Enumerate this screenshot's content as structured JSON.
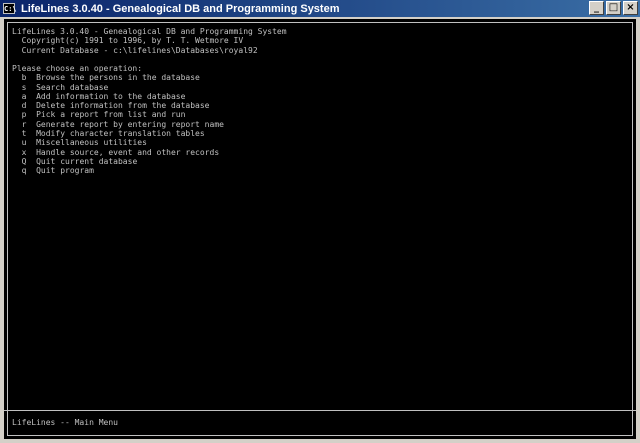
{
  "window": {
    "title": "LifeLines 3.0.40 - Genealogical DB and Programming System",
    "minimize": "_",
    "maximize": "□",
    "close": "×"
  },
  "header": {
    "line1": "LifeLines 3.0.40 - Genealogical DB and Programming System",
    "line2": "  Copyright(c) 1991 to 1996, by T. T. Wetmore IV",
    "line3": "  Current Database - c:\\lifelines\\Databases\\royal92"
  },
  "menu": {
    "prompt": "Please choose an operation:",
    "items": [
      {
        "key": "b",
        "label": "Browse the persons in the database"
      },
      {
        "key": "s",
        "label": "Search database"
      },
      {
        "key": "a",
        "label": "Add information to the database"
      },
      {
        "key": "d",
        "label": "Delete information from the database"
      },
      {
        "key": "p",
        "label": "Pick a report from list and run"
      },
      {
        "key": "r",
        "label": "Generate report by entering report name"
      },
      {
        "key": "t",
        "label": "Modify character translation tables"
      },
      {
        "key": "u",
        "label": "Miscellaneous utilities"
      },
      {
        "key": "x",
        "label": "Handle source, event and other records"
      },
      {
        "key": "Q",
        "label": "Quit current database"
      },
      {
        "key": "q",
        "label": "Quit program"
      }
    ]
  },
  "status": "LifeLines -- Main Menu"
}
